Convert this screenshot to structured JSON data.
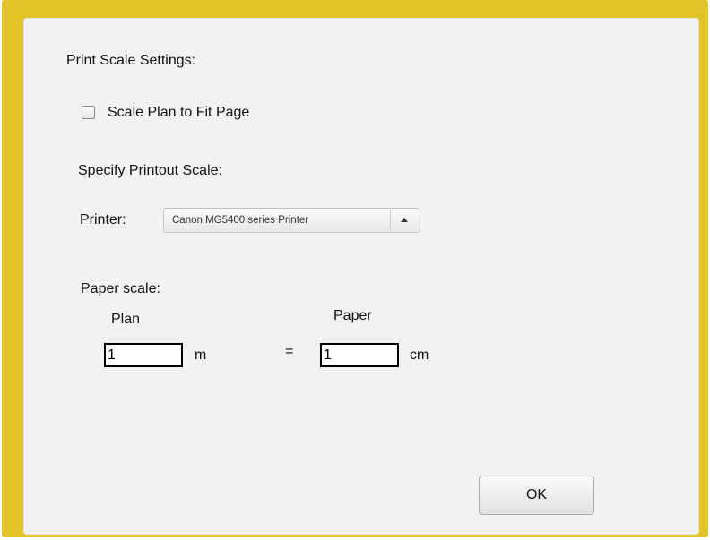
{
  "dialog": {
    "section_title": "Print Scale Settings:",
    "fit_page_checkbox": {
      "label": "Scale Plan to Fit Page",
      "checked": false
    },
    "specify_scale_label": "Specify Printout Scale:",
    "printer": {
      "label": "Printer:",
      "selected": "Canon MG5400 series Printer"
    },
    "paper_scale": {
      "label": "Paper scale:",
      "plan_header": "Plan",
      "paper_header": "Paper",
      "plan_value": "1",
      "plan_unit": "m",
      "equals": "=",
      "paper_value": "1",
      "paper_unit": "cm"
    },
    "ok_label": "OK"
  },
  "colors": {
    "frame": "#e2c428",
    "dialog_background": "#f2f2f2"
  }
}
